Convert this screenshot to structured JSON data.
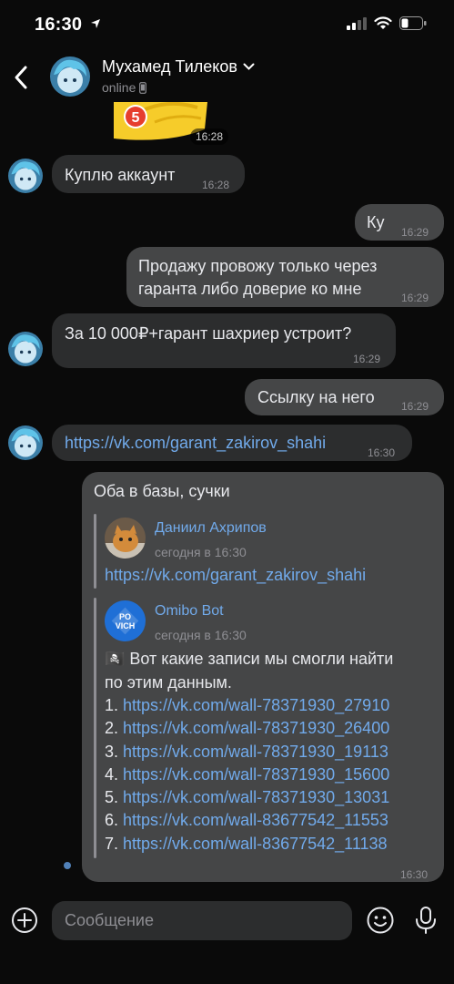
{
  "status_bar": {
    "time": "16:30"
  },
  "header": {
    "name": "Мухамед Тилеков",
    "status": "online"
  },
  "sticker": {
    "time": "16:28"
  },
  "messages": {
    "m1": {
      "text": "Куплю аккаунт",
      "time": "16:28"
    },
    "m2": {
      "text": "Ку",
      "time": "16:29"
    },
    "m3": {
      "line1": "Продажу провожу только через",
      "line2": "гаранта либо доверие ко мне",
      "time": "16:29"
    },
    "m4": {
      "text": "За 10 000₽+гарант шахриер устроит?",
      "time": "16:29"
    },
    "m5": {
      "text": "Ссылку на него",
      "time": "16:29"
    },
    "m6": {
      "text": "https://vk.com/garant_zakirov_shahi",
      "time": "16:30"
    },
    "m7": {
      "text": "Оба в базы, сучки",
      "time": "16:30",
      "fwd1": {
        "author": "Даниил Ахрипов",
        "date": "сегодня в 16:30",
        "text": "https://vk.com/garant_zakirov_shahi"
      },
      "fwd2": {
        "author": "Omibo Bot",
        "date": "сегодня в 16:30",
        "avatar_text": "PO VICH",
        "line1": "🏴‍☠️ Вот какие записи мы смогли найти",
        "line2": "по этим данным.",
        "links": [
          {
            "num": "1.",
            "url": "https://vk.com/wall-78371930_27910"
          },
          {
            "num": "2.",
            "url": "https://vk.com/wall-78371930_26400"
          },
          {
            "num": "3.",
            "url": "https://vk.com/wall-78371930_19113"
          },
          {
            "num": "4.",
            "url": "https://vk.com/wall-78371930_15600"
          },
          {
            "num": "5.",
            "url": "https://vk.com/wall-78371930_13031"
          },
          {
            "num": "6.",
            "url": "https://vk.com/wall-83677542_11553"
          },
          {
            "num": "7.",
            "url": "https://vk.com/wall-83677542_11138"
          }
        ]
      }
    }
  },
  "composer": {
    "placeholder": "Сообщение"
  },
  "icons": {
    "back": "chevron-left-icon",
    "chevron": "chevron-down-icon",
    "phone": "phone-icon",
    "plus": "plus-circle-icon",
    "smile": "smile-icon",
    "mic": "microphone-icon"
  },
  "colors": {
    "background": "#0a0a0a",
    "incoming_bubble": "#2c2d2e",
    "outgoing_bubble": "#454647",
    "link": "#71aaeb",
    "secondary_text": "#8e8e93"
  }
}
